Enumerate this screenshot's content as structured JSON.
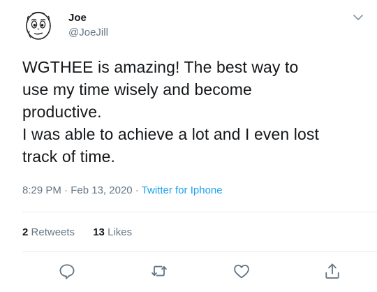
{
  "tweet": {
    "author": {
      "display_name": "Joe",
      "handle": "@JoeJill",
      "avatar_icon": "cartoon-face-avatar"
    },
    "text_lines": [
      "WGTHEE is amazing! The best way to",
      "use my time wisely and become",
      "productive.",
      "I was able to achieve a lot and I even lost",
      "track of time."
    ],
    "time": "8:29 PM",
    "date": "Feb 13, 2020",
    "separator": "·",
    "client": "Twitter for Iphone",
    "stats": {
      "retweets_count": "2",
      "retweets_label": "Retweets",
      "likes_count": "13",
      "likes_label": "Likes"
    },
    "actions": [
      "reply-icon",
      "retweet-icon",
      "like-icon",
      "share-icon"
    ],
    "colors": {
      "text": "#14171a",
      "secondary": "#657786",
      "accent": "#1da1f2",
      "divider": "#e6ecf0"
    }
  }
}
